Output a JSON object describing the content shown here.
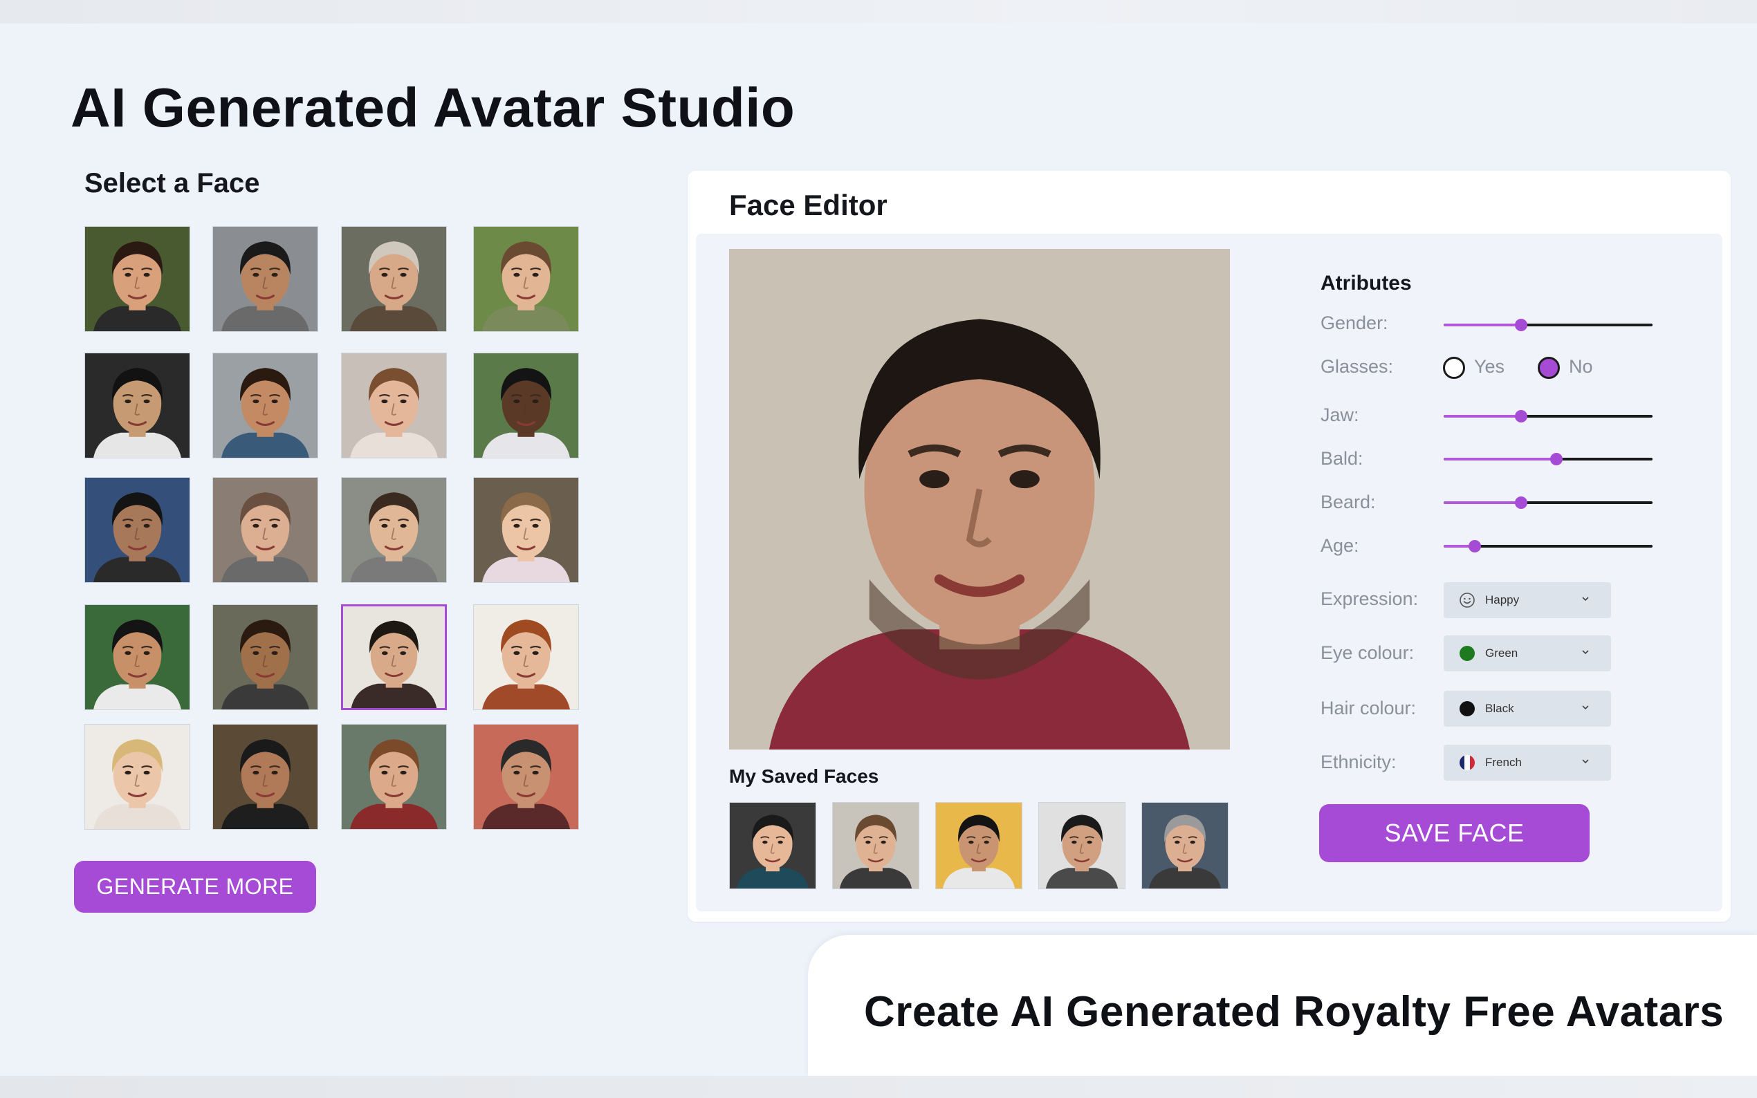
{
  "app": {
    "title": "AI Generated Avatar Studio"
  },
  "select_face": {
    "title": "Select a Face"
  },
  "grid_faces": [
    {
      "skin": "#d9a07c",
      "hair": "#2a1a12",
      "bg": "#4a5a30",
      "shirt": "#2a2a2a"
    },
    {
      "skin": "#b98560",
      "hair": "#1a1a1a",
      "bg": "#8a8e92",
      "shirt": "#6a6a6a"
    },
    {
      "skin": "#d8a988",
      "hair": "#d0c8bc",
      "bg": "#6b6d60",
      "shirt": "#5a4a3a"
    },
    {
      "skin": "#e2b594",
      "hair": "#6a4a30",
      "bg": "#6e8a48",
      "shirt": "#7a8a5a"
    },
    {
      "skin": "#c69a72",
      "hair": "#121212",
      "bg": "#2a2a2a",
      "shirt": "#e6e6e6"
    },
    {
      "skin": "#c48a64",
      "hair": "#2a1a10",
      "bg": "#9aa0a4",
      "shirt": "#3a5a7a"
    },
    {
      "skin": "#e4b69a",
      "hair": "#7a4e30",
      "bg": "#c8c0b8",
      "shirt": "#e8e0d8"
    },
    {
      "skin": "#5a3a26",
      "hair": "#141414",
      "bg": "#5a7a4a",
      "shirt": "#e6e6ea"
    },
    {
      "skin": "#a8785a",
      "hair": "#141414",
      "bg": "#34507a",
      "shirt": "#2a2a2a"
    },
    {
      "skin": "#dcae92",
      "hair": "#6a5040",
      "bg": "#8a7e74",
      "shirt": "#6a6a6a"
    },
    {
      "skin": "#e0b898",
      "hair": "#3a2a20",
      "bg": "#8a8e86",
      "shirt": "#7a7a7a"
    },
    {
      "skin": "#ecc4a6",
      "hair": "#8a6a48",
      "bg": "#6a5e4e",
      "shirt": "#e8d8e0"
    },
    {
      "skin": "#c89068",
      "hair": "#141414",
      "bg": "#3a6a3a",
      "shirt": "#eaeaea"
    },
    {
      "skin": "#a0704a",
      "hair": "#2a1a10",
      "bg": "#6a6a5a",
      "shirt": "#3a3a3a"
    },
    {
      "skin": "#d8aa8a",
      "hair": "#1e1812",
      "bg": "#e8e4de",
      "shirt": "#3a2a28"
    },
    {
      "skin": "#e4b898",
      "hair": "#a04a22",
      "bg": "#f0ece6",
      "shirt": "#a04a2a"
    },
    {
      "skin": "#ecc6a8",
      "hair": "#d8b878",
      "bg": "#eeeae6",
      "shirt": "#e8e0d8"
    },
    {
      "skin": "#b07a58",
      "hair": "#1a1a1a",
      "bg": "#5a4a36",
      "shirt": "#1e1e1e"
    },
    {
      "skin": "#dcaa8a",
      "hair": "#7a4a2a",
      "bg": "#6a7a6a",
      "shirt": "#8a2a2a"
    },
    {
      "skin": "#c89272",
      "hair": "#2a2a2a",
      "bg": "#c86a5a",
      "shirt": "#5a2a2a"
    }
  ],
  "actions": {
    "generate_more": "GENERATE MORE",
    "save_face": "SAVE FACE"
  },
  "editor": {
    "title": "Face Editor",
    "main_face": {
      "skin": "#c9957a",
      "hair": "#1e1612",
      "bg": "#c9c2b4",
      "shirt": "#8a2a3a",
      "beard": "#4a3428"
    },
    "saved_title": "My Saved Faces",
    "saved_faces": [
      {
        "skin": "#e6b898",
        "hair": "#1a1a1a",
        "bg": "#3a3a3a",
        "shirt": "#1e4a5a"
      },
      {
        "skin": "#e0b294",
        "hair": "#6a4a30",
        "bg": "#c8c4bc",
        "shirt": "#3a3a3a"
      },
      {
        "skin": "#c89472",
        "hair": "#141414",
        "bg": "#e8b84a",
        "shirt": "#e8e8e8"
      },
      {
        "skin": "#d0a080",
        "hair": "#1a1a1a",
        "bg": "#e0e0e0",
        "shirt": "#4a4a4a"
      },
      {
        "skin": "#dcae92",
        "hair": "#9a9a9a",
        "bg": "#4a5a6a",
        "shirt": "#3a3a3a"
      }
    ]
  },
  "attributes": {
    "heading": "Atributes",
    "gender": {
      "label": "Gender:",
      "value": 0.37
    },
    "glasses": {
      "label": "Glasses:",
      "yes": "Yes",
      "no": "No",
      "selected": "No"
    },
    "jaw": {
      "label": "Jaw:",
      "value": 0.37
    },
    "bald": {
      "label": "Bald:",
      "value": 0.54
    },
    "beard": {
      "label": "Beard:",
      "value": 0.37
    },
    "age": {
      "label": "Age:",
      "value": 0.15
    },
    "expression": {
      "label": "Expression:",
      "value": "Happy",
      "icon": "smiley-icon"
    },
    "eye_colour": {
      "label": "Eye colour:",
      "value": "Green",
      "color": "#1e7a1e"
    },
    "hair_colour": {
      "label": "Hair colour:",
      "value": "Black",
      "color": "#111111"
    },
    "ethnicity": {
      "label": "Ethnicity:",
      "value": "French",
      "icon": "french-flag-icon"
    }
  },
  "banner": {
    "text": "Create AI Generated Royalty Free Avatars"
  },
  "colors": {
    "accent": "#a64bd6",
    "page_bg": "#eef3fa",
    "panel_bg": "#ffffff"
  }
}
